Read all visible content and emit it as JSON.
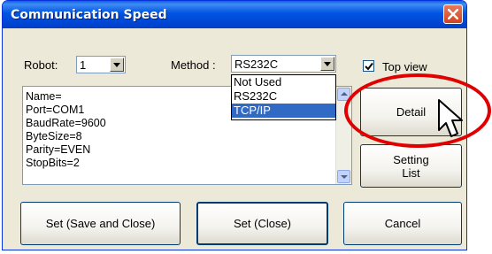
{
  "window": {
    "title": "Communication Speed"
  },
  "robot": {
    "label": "Robot:",
    "value": "1"
  },
  "method": {
    "label": "Method :",
    "value": "RS232C",
    "options": [
      "Not Used",
      "RS232C",
      "TCP/IP"
    ],
    "highlighted": "TCP/IP"
  },
  "top_view": {
    "label": "Top view",
    "checked": true
  },
  "settings_text": [
    "Name=",
    "Port=COM1",
    "BaudRate=9600",
    "ByteSize=8",
    "Parity=EVEN",
    "StopBits=2"
  ],
  "buttons": {
    "detail": "Detail",
    "setting_list_line1": "Setting",
    "setting_list_line2": "List",
    "save_close": "Set (Save and Close)",
    "set_close": "Set (Close)",
    "cancel": "Cancel"
  },
  "colors": {
    "title_bar": "#0054e3",
    "highlight": "#316ac5",
    "callout": "#e00000"
  }
}
